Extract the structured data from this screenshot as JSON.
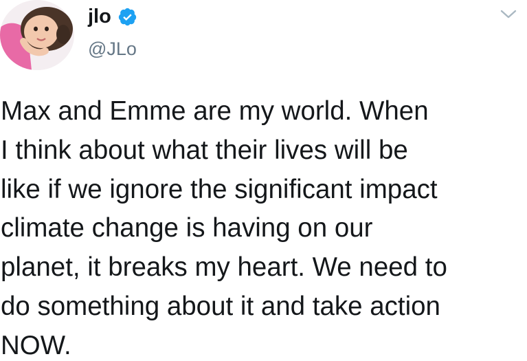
{
  "tweet": {
    "display_name": "jlo",
    "verified": true,
    "handle": "@JLo",
    "text": "Max and Emme are my world. When\nI think about what their lives will be\nlike if we ignore the significant impact\nclimate change is having on our\nplanet, it breaks my heart. We need to\ndo something about it and take action\nNOW.",
    "icons": {
      "verified": "verified-badge-icon",
      "menu": "chevron-down-icon"
    }
  },
  "colors": {
    "text": "#14171a",
    "handle": "#657786",
    "verified_badge": "#1da1f2",
    "avatar_pink": "#e86aa6"
  }
}
